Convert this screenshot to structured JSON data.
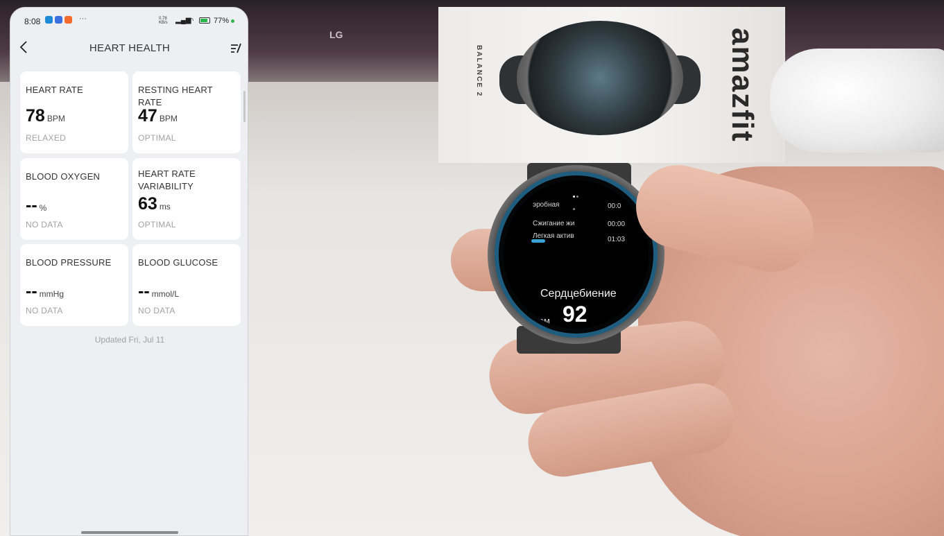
{
  "status_bar": {
    "time": "8:08",
    "more": "···",
    "net_speed_value": "0.78",
    "net_speed_unit": "KB/s",
    "battery_pct": "77",
    "app_icon_colors": [
      "#1c8ad6",
      "#3a6fe0",
      "#f36a2b"
    ],
    "charging_color": "#2db84d"
  },
  "header": {
    "title": "HEART HEALTH",
    "back_icon": "chevron-left-icon",
    "edit_icon": "edit-list-icon"
  },
  "cards": [
    {
      "label": "HEART RATE",
      "value": "78",
      "unit": "BPM",
      "status": "RELAXED"
    },
    {
      "label": "RESTING HEART RATE",
      "value": "47",
      "unit": "BPM",
      "status": "OPTIMAL"
    },
    {
      "label": "BLOOD OXYGEN",
      "value": "--",
      "unit": "%",
      "status": "NO DATA"
    },
    {
      "label": "HEART RATE VARIABILITY",
      "value": "63",
      "unit": "ms",
      "status": "OPTIMAL"
    },
    {
      "label": "BLOOD PRESSURE",
      "value": "--",
      "unit": "mmHg",
      "status": "NO DATA"
    },
    {
      "label": "BLOOD GLUCOSE",
      "value": "--",
      "unit": "mmol/L",
      "status": "NO DATA"
    }
  ],
  "updated": "Updated Fri, Jul 11",
  "watch": {
    "rows": [
      {
        "name": "эробная",
        "time": "00:0"
      },
      {
        "name": "Сжигание жи",
        "time": "00:00"
      },
      {
        "name": "Легкая актив",
        "time": "01:03"
      }
    ],
    "title": "Сердцебиение",
    "value": "92",
    "sub": "чем",
    "accent": "#1f5d7e"
  },
  "box": {
    "brand": "amazfit",
    "model": "BALANCE 2"
  },
  "tv_logo": "LG"
}
